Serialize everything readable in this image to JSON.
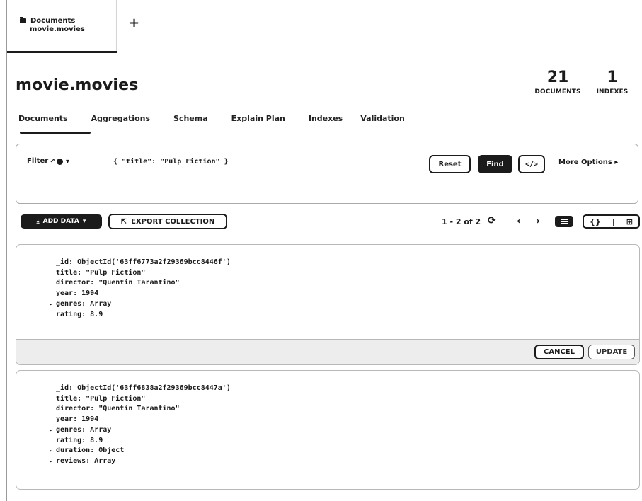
{
  "tabbar": {
    "tab_type": "Documents",
    "tab_namespace": "movie.movies",
    "add_tab_symbol": "+"
  },
  "header": {
    "namespace": "movie.movies",
    "documents_count": "21",
    "documents_label": "DOCUMENTS",
    "indexes_count": "1",
    "indexes_label": "INDEXES"
  },
  "nav_tabs": [
    "Documents",
    "Aggregations",
    "Schema",
    "Explain Plan",
    "Indexes",
    "Validation"
  ],
  "filter": {
    "label": "Filter",
    "query": "{ \"title\": \"Pulp Fiction\" }",
    "reset_label": "Reset",
    "find_label": "Find",
    "code_label": "</>",
    "more_options_label": "More Options ▸"
  },
  "toolbar": {
    "add_data_label": "ADD DATA",
    "export_label": "EXPORT COLLECTION",
    "pagination": "1 - 2 of 2",
    "view_seg_json": "{}",
    "view_seg_sep": "|",
    "view_seg_table": "⊞"
  },
  "documents": [
    {
      "lines": [
        {
          "caret": "",
          "text": "_id: ObjectId('63ff6773a2f29369bcc8446f')"
        },
        {
          "caret": "",
          "text": "title: \"Pulp Fiction\""
        },
        {
          "caret": "",
          "text": "director: \"Quentin Tarantino\""
        },
        {
          "caret": "",
          "text": "year: 1994"
        },
        {
          "caret": "▸",
          "text": "genres: Array"
        },
        {
          "caret": "",
          "text": "rating: 8.9"
        }
      ],
      "cancel_label": "CANCEL",
      "update_label": "UPDATE"
    },
    {
      "lines": [
        {
          "caret": "",
          "text": "_id: ObjectId('63ff6838a2f29369bcc8447a')"
        },
        {
          "caret": "",
          "text": "title: \"Pulp Fiction\""
        },
        {
          "caret": "",
          "text": "director: \"Quentin Tarantino\""
        },
        {
          "caret": "",
          "text": "year: 1994"
        },
        {
          "caret": "▸",
          "text": "genres: Array"
        },
        {
          "caret": "",
          "text": "rating: 8.9"
        },
        {
          "caret": "▸",
          "text": "duration: Object"
        },
        {
          "caret": "▸",
          "text": "reviews: Array"
        }
      ]
    }
  ]
}
